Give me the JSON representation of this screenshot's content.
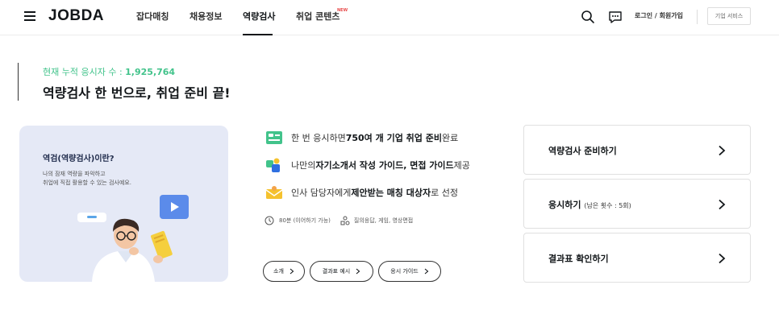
{
  "header": {
    "logo": "JOBDA",
    "nav": [
      "잡다매칭",
      "채용정보",
      "역량검사",
      "취업 콘텐츠"
    ],
    "new_badge": "NEW",
    "login": "로그인 / 회원가입",
    "corp_service": "기업 서비스"
  },
  "hero": {
    "counter_label": "현재 누적 응시자 수 : ",
    "counter_value": "1,925,764",
    "headline": "역량검사 한 번으로, 취업 준비 끝!"
  },
  "card": {
    "title": "역검(역량검사)이란?",
    "desc_line1": "나의 잠재 역량을 파악하고",
    "desc_line2": "취업에 직접 활용할 수 있는 검사예요."
  },
  "features": [
    {
      "pre": "한 번 응시하면 ",
      "bold": "750여 개 기업 취업 준비",
      "post": " 완료",
      "icon": "id-card-icon"
    },
    {
      "pre": "나만의 ",
      "bold": "자기소개서 작성 가이드, 면접 가이드",
      "post": " 제공",
      "icon": "puzzle-icon"
    },
    {
      "pre": "인사 담당자에게 ",
      "bold": "제안받는 매칭 대상자",
      "post": "로 선정",
      "icon": "envelope-icon"
    }
  ],
  "meta": {
    "duration": "80분 (이어하기 가능)",
    "types": "질의응답, 게임, 영상면접"
  },
  "pills": [
    "소개",
    "결과표 예시",
    "응시 가이드"
  ],
  "actions": [
    {
      "label": "역량검사 준비하기",
      "sub": ""
    },
    {
      "label": "응시하기",
      "sub": "(남은 횟수 : 5회)"
    },
    {
      "label": "결과표 확인하기",
      "sub": ""
    }
  ],
  "colors": {
    "accent_green": "#42c38b",
    "card_bg": "#e5e9f6",
    "play_blue": "#5b8bea"
  }
}
